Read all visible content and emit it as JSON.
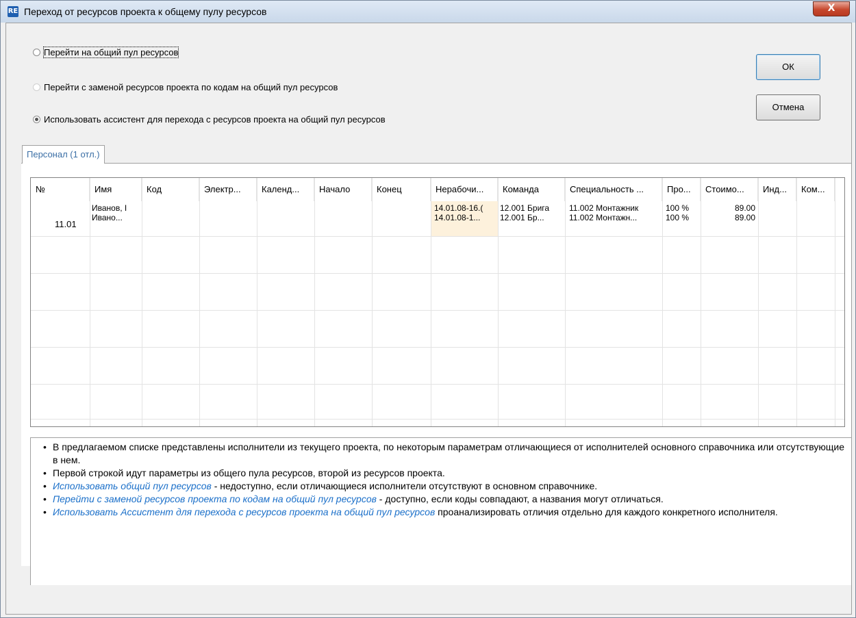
{
  "window": {
    "title": "Переход от ресурсов проекта к общему пулу ресурсов",
    "app_icon": "RE",
    "close_glyph": "X"
  },
  "options": [
    {
      "label": "Перейти на общий пул ресурсов",
      "checked": false,
      "enabled": true
    },
    {
      "label": "Перейти с заменой ресурсов проекта по кодам на общий пул ресурсов",
      "checked": false,
      "enabled": false
    },
    {
      "label": "Использовать ассистент для перехода с ресурсов проекта на общий пул ресурсов",
      "checked": true,
      "enabled": true
    }
  ],
  "buttons": {
    "ok": "ОК",
    "cancel": "Отмена"
  },
  "tab": {
    "label": "Персонал (1 отл.)"
  },
  "grid": {
    "columns": [
      "№",
      "Имя",
      "Код",
      "Электр...",
      "Календ...",
      "Начало",
      "Конец",
      "Нерабочи...",
      "Команда",
      "Специальность ...",
      "Про...",
      "Стоимо...",
      "Инд...",
      "Ком..."
    ],
    "row": {
      "number": "11.01",
      "name": [
        "Иванов, I",
        "Ивано..."
      ],
      "nonworking": [
        "14.01.08-16.(",
        "14.01.08-1..."
      ],
      "team": [
        "12.001 Брига",
        "12.001 Бр..."
      ],
      "specialty": [
        "11.002 Монтажник",
        "11.002 Монтажн..."
      ],
      "percent": [
        "100 %",
        "100 %"
      ],
      "cost": [
        "89.00",
        "89.00"
      ]
    }
  },
  "info": {
    "line1": "В предлагаемом списке представлены исполнители из текущего проекта, по некоторым параметрам отличающиеся от исполнителей основного справочника или отсутствующие в нем.",
    "line2": "Первой строкой идут параметры из общего пула ресурсов, второй из ресурсов проекта.",
    "line3_link": "Использовать общий пул ресурсов",
    "line3_text": " - недоступно, если отличающиеся исполнители отсутствуют в основном справочнике.",
    "line4_link": "Перейти с заменой ресурсов проекта по кодам на общий пул ресурсов",
    "line4_text": " - доступно, если коды совпадают, а названия могут отличаться.",
    "line5_link": "Использовать Ассистент для перехода с ресурсов проекта на общий пул ресурсов",
    "line5_text": " проанализировать отличия отдельно для каждого конкретного исполнителя."
  }
}
